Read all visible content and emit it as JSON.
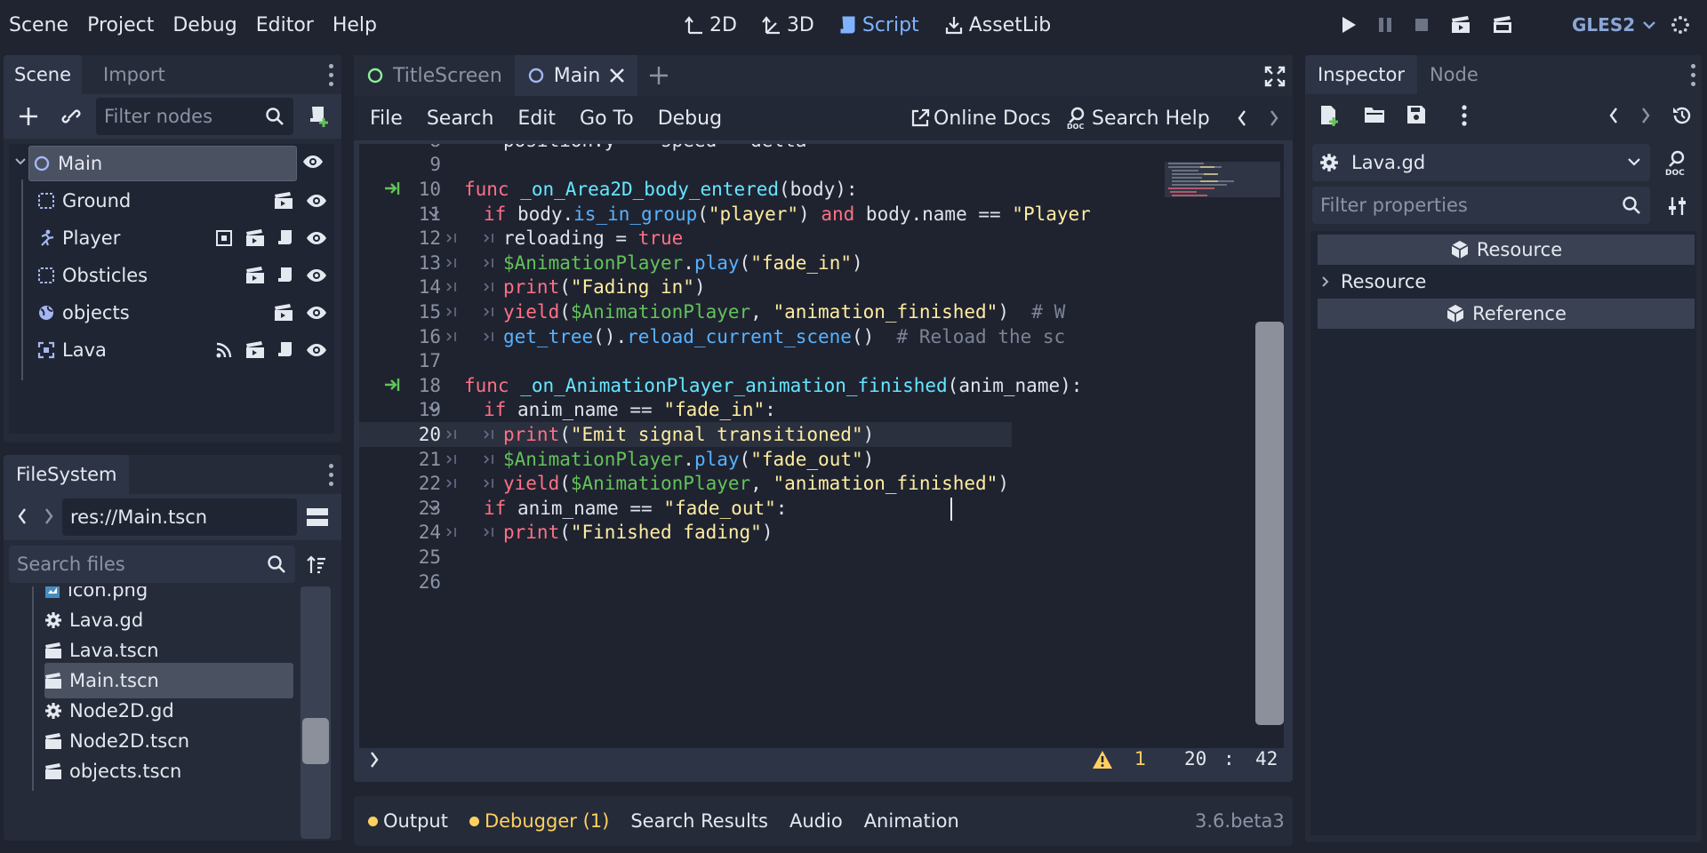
{
  "menu": [
    "Scene",
    "Project",
    "Debug",
    "Editor",
    "Help"
  ],
  "modes": [
    {
      "label": "2D",
      "icon": "2d-icon",
      "active": false
    },
    {
      "label": "3D",
      "icon": "3d-icon",
      "active": false
    },
    {
      "label": "Script",
      "icon": "script-icon",
      "active": true
    },
    {
      "label": "AssetLib",
      "icon": "assetlib-icon",
      "active": false
    }
  ],
  "renderer": "GLES2",
  "scene_dock": {
    "tabs": [
      "Scene",
      "Import"
    ],
    "filter_placeholder": "Filter nodes",
    "nodes": [
      {
        "name": "Main",
        "icon": "node2d-circle-icon",
        "selected": true
      },
      {
        "name": "Ground",
        "icon": "node2d-rect-icon"
      },
      {
        "name": "Player",
        "icon": "kinematic-body-icon"
      },
      {
        "name": "Obsticles",
        "icon": "node2d-rect-icon"
      },
      {
        "name": "objects",
        "icon": "globe-icon"
      },
      {
        "name": "Lava",
        "icon": "area2d-icon"
      }
    ]
  },
  "filesystem": {
    "tab": "FileSystem",
    "path": "res://Main.tscn",
    "search_placeholder": "Search files",
    "files": [
      {
        "name": "icon.png",
        "icon": "image-icon"
      },
      {
        "name": "Lava.gd",
        "icon": "gear-icon"
      },
      {
        "name": "Lava.tscn",
        "icon": "scene-clapper-icon"
      },
      {
        "name": "Main.tscn",
        "icon": "scene-clapper-icon",
        "selected": true
      },
      {
        "name": "Node2D.gd",
        "icon": "gear-icon"
      },
      {
        "name": "Node2D.tscn",
        "icon": "scene-clapper-icon"
      },
      {
        "name": "objects.tscn",
        "icon": "scene-clapper-icon"
      }
    ]
  },
  "editor": {
    "tabs": [
      {
        "label": "TitleScreen",
        "active": false
      },
      {
        "label": "Main",
        "active": true
      }
    ],
    "menu": [
      "File",
      "Search",
      "Edit",
      "Go To",
      "Debug"
    ],
    "online_docs": "Online Docs",
    "search_help": "Search Help",
    "warning_count": "1",
    "cursor_line": "20",
    "cursor_sep": ":",
    "cursor_col": "42",
    "lines": [
      {
        "n": "8",
        "partial": true,
        "html": "    position.y -= speed * delta"
      },
      {
        "n": "9",
        "html": ""
      },
      {
        "n": "10",
        "connected": true,
        "html": "<span class=\"kw\">func</span> <span class=\"fn\">_on_Area2D_body_entered</span>(body):"
      },
      {
        "n": "11",
        "fold": true,
        "html": "  <span class=\"kw\">if</span> body.<span class=\"mc\">is_in_group</span>(<span class=\"st\">\"player\"</span>) <span class=\"kw\">and</span> body.name == <span class=\"st\">\"Player</span>"
      },
      {
        "n": "12",
        "html": "    reloading = <span class=\"bl\">true</span>"
      },
      {
        "n": "13",
        "html": "    <span class=\"nd\">$AnimationPlayer</span>.<span class=\"mc\">play</span>(<span class=\"st\">\"fade_in\"</span>)"
      },
      {
        "n": "14",
        "html": "    <span class=\"kw\">print</span>(<span class=\"st\">\"Fading in\"</span>)"
      },
      {
        "n": "15",
        "html": "    <span class=\"kw\">yield</span>(<span class=\"nd\">$AnimationPlayer</span>, <span class=\"st\">\"animation_finished\"</span>)  <span class=\"cm\"># W</span>"
      },
      {
        "n": "16",
        "html": "    <span class=\"mc\">get_tree</span>().<span class=\"mc\">reload_current_scene</span>()  <span class=\"cm\"># Reload the sc</span>"
      },
      {
        "n": "17",
        "html": ""
      },
      {
        "n": "18",
        "connected": true,
        "html": "<span class=\"kw\">func</span> <span class=\"fn\">_on_AnimationPlayer_animation_finished</span>(anim_name):"
      },
      {
        "n": "19",
        "fold": true,
        "html": "  <span class=\"kw\">if</span> anim_name == <span class=\"st\">\"fade_in\"</span>:"
      },
      {
        "n": "20",
        "current": true,
        "html": "    <span class=\"kw\">print</span>(<span class=\"st\">\"Emit signal transitioned\"</span>)"
      },
      {
        "n": "21",
        "html": "    <span class=\"nd\">$AnimationPlayer</span>.<span class=\"mc\">play</span>(<span class=\"st\">\"fade_out\"</span>)"
      },
      {
        "n": "22",
        "html": "    <span class=\"kw\">yield</span>(<span class=\"nd\">$AnimationPlayer</span>, <span class=\"st\">\"animation_finished\"</span>)"
      },
      {
        "n": "23",
        "fold": true,
        "html": "  <span class=\"kw\">if</span> anim_name == <span class=\"st\">\"fade_out\"</span>:"
      },
      {
        "n": "24",
        "html": "    <span class=\"kw\">print</span>(<span class=\"st\">\"Finished fading\"</span>)"
      },
      {
        "n": "25",
        "html": ""
      },
      {
        "n": "26",
        "html": ""
      }
    ]
  },
  "bottom_panel": {
    "tabs": [
      {
        "label": "Output",
        "dot": true,
        "highlight": false
      },
      {
        "label": "Debugger (1)",
        "dot": true,
        "highlight": true
      },
      {
        "label": "Search Results"
      },
      {
        "label": "Audio"
      },
      {
        "label": "Animation"
      }
    ],
    "version": "3.6.beta3"
  },
  "inspector": {
    "tabs": [
      "Inspector",
      "Node"
    ],
    "resource_name": "Lava.gd",
    "filter_placeholder": "Filter properties",
    "section_resource": "Resource",
    "subsection_resource": "Resource",
    "section_reference": "Reference"
  },
  "colors": {
    "accent": "#7fb3ff",
    "keyword": "#ff7085",
    "function": "#66e6ff",
    "string": "#ffeda1",
    "warning": "#ffd060",
    "connected_signal": "#63c259"
  }
}
